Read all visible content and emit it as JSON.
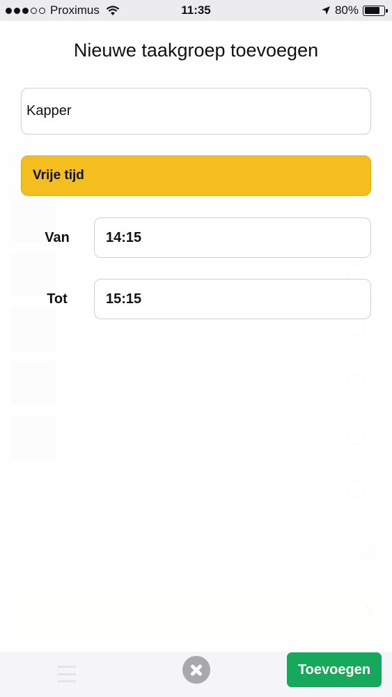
{
  "status_bar": {
    "carrier": "Proximus",
    "time": "11:35",
    "battery": "80%",
    "battery_level": 0.8
  },
  "modal": {
    "title": "Nieuwe taakgroep toevoegen",
    "name_value": "Kapper",
    "category_value": "Vrije tijd",
    "category_color": "#f5be1f",
    "from_label": "Van",
    "from_value": "14:15",
    "to_label": "Tot",
    "to_value": "15:15"
  },
  "bottom_bar": {
    "add_label": "Toevoegen",
    "add_color": "#17a95b",
    "icons": [
      "menu-icon",
      "close-icon"
    ]
  }
}
